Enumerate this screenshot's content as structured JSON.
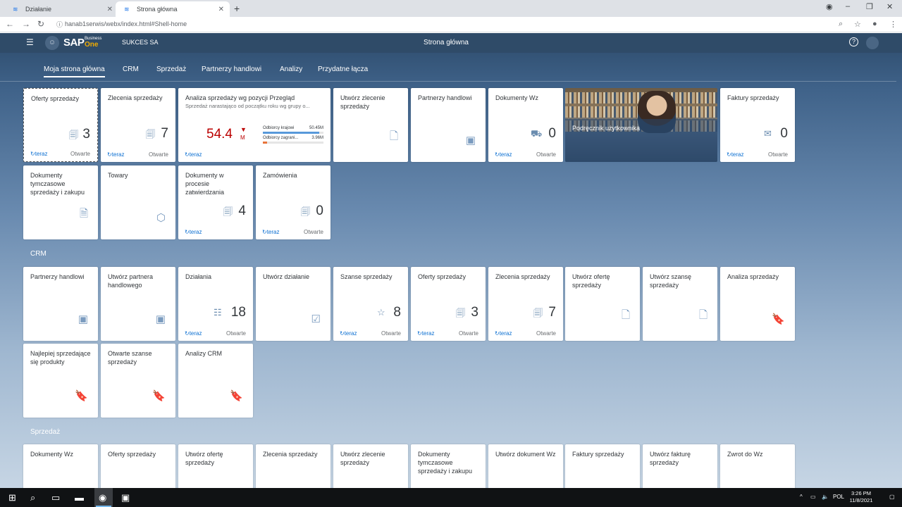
{
  "browser": {
    "tabs": [
      {
        "title": "Działanie",
        "active": false
      },
      {
        "title": "Strona główna",
        "active": true
      }
    ],
    "url": "hanab1serwis/webx/index.html#Shell-home"
  },
  "shell": {
    "logo_text": "SAP",
    "logo_business": "Business",
    "logo_one": "One",
    "company": "SUKCES SA",
    "title": "Strona główna"
  },
  "nav_tabs": [
    "Moja strona główna",
    "CRM",
    "Sprzedaż",
    "Partnerzy handlowi",
    "Analizy",
    "Przydatne łącza"
  ],
  "common": {
    "refresh": "teraz",
    "open": "Otwarte"
  },
  "my_home": {
    "t1": {
      "title": "Oferty sprzedaży",
      "count": "3"
    },
    "t2": {
      "title": "Zlecenia sprzedaży",
      "count": "7"
    },
    "t3": {
      "title": "Analiza sprzedaży wg pozycji Przegląd",
      "subtitle": "Sprzedaż narastająco od początku roku wg grupy o...",
      "kpi": "54.4",
      "unit": "M",
      "bars": [
        {
          "label": "Odbiorcy krajowi",
          "value": "50.45M",
          "fraction": 0.93,
          "color": "#5899da"
        },
        {
          "label": "Odbiorcy zagrani...",
          "value": "3.96M",
          "fraction": 0.07,
          "color": "#e8743b"
        }
      ]
    },
    "t4": {
      "title": "Utwórz zlecenie sprzedaży"
    },
    "t5": {
      "title": "Partnerzy handlowi"
    },
    "t6": {
      "title": "Dokumenty Wz",
      "count": "0"
    },
    "t7": {
      "title": "Podręcznik użytkownika"
    },
    "t8": {
      "title": "Faktury sprzedaży",
      "count": "0"
    },
    "t9": {
      "title": "Dokumenty tymczasowe sprzedaży i zakupu"
    },
    "t10": {
      "title": "Towary"
    },
    "t11": {
      "title": "Dokumenty w procesie zatwierdzania",
      "count": "4"
    },
    "t12": {
      "title": "Zamówienia",
      "count": "0"
    }
  },
  "crm": {
    "section": "CRM",
    "t1": {
      "title": "Partnerzy handlowi"
    },
    "t2": {
      "title": "Utwórz partnera handlowego"
    },
    "t3": {
      "title": "Działania",
      "count": "18"
    },
    "t4": {
      "title": "Utwórz działanie"
    },
    "t5": {
      "title": "Szanse sprzedaży",
      "count": "8"
    },
    "t6": {
      "title": "Oferty sprzedaży",
      "count": "3"
    },
    "t7": {
      "title": "Zlecenia sprzedaży",
      "count": "7"
    },
    "t8": {
      "title": "Utwórz ofertę sprzedaży"
    },
    "t9": {
      "title": "Utwórz szansę sprzedaży"
    },
    "t10": {
      "title": "Analiza sprzedaży"
    },
    "t11": {
      "title": "Najlepiej sprzedające się produkty"
    },
    "t12": {
      "title": "Otwarte szanse sprzedaży"
    },
    "t13": {
      "title": "Analizy CRM"
    }
  },
  "sales": {
    "section": "Sprzedaż",
    "t1": {
      "title": "Dokumenty Wz"
    },
    "t2": {
      "title": "Oferty sprzedaży"
    },
    "t3": {
      "title": "Utwórz ofertę sprzedaży"
    },
    "t4": {
      "title": "Zlecenia sprzedaży"
    },
    "t5": {
      "title": "Utwórz zlecenie sprzedaży"
    },
    "t6": {
      "title": "Dokumenty tymczasowe sprzedaży i zakupu"
    },
    "t7": {
      "title": "Utwórz dokument Wz"
    },
    "t8": {
      "title": "Faktury sprzedaży"
    },
    "t9": {
      "title": "Utwórz fakturę sprzedaży"
    },
    "t10": {
      "title": "Zwrot do Wz"
    }
  },
  "taskbar": {
    "lang": "POL",
    "time": "3:26 PM",
    "date": "11/8/2021"
  }
}
